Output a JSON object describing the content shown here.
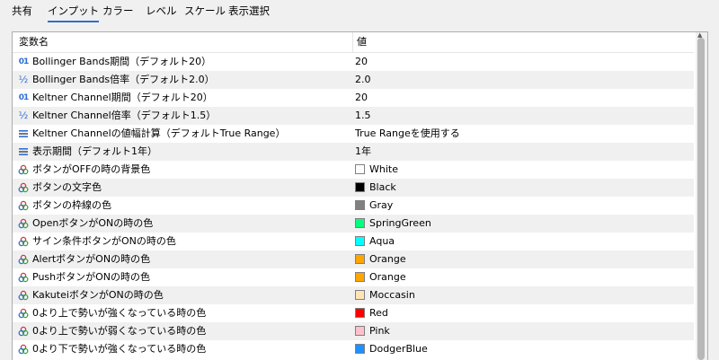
{
  "tabs": [
    {
      "label": "共有",
      "active": false
    },
    {
      "label": "インプット",
      "active": true
    },
    {
      "label": "カラー",
      "active": false
    },
    {
      "label": "レベル",
      "active": false
    },
    {
      "label": "スケール",
      "active": false
    },
    {
      "label": "表示選択",
      "active": false
    }
  ],
  "table": {
    "header_name": "変数名",
    "header_value": "値",
    "rows": [
      {
        "icon": "integer-icon",
        "name": "Bollinger Bands期間（デフォルト20）",
        "value": "20"
      },
      {
        "icon": "fraction-icon",
        "name": "Bollinger Bands倍率（デフォルト2.0）",
        "value": "2.0"
      },
      {
        "icon": "integer-icon",
        "name": "Keltner Channel期間（デフォルト20）",
        "value": "20"
      },
      {
        "icon": "fraction-icon",
        "name": "Keltner Channel倍率（デフォルト1.5）",
        "value": "1.5"
      },
      {
        "icon": "enum-icon",
        "name": "Keltner Channelの値幅計算（デフォルトTrue Range）",
        "value": "True Rangeを使用する"
      },
      {
        "icon": "enum-icon",
        "name": "表示期間（デフォルト1年）",
        "value": "1年"
      },
      {
        "icon": "color-icon",
        "name": "ボタンがOFFの時の背景色",
        "value": "White",
        "swatch": "#ffffff"
      },
      {
        "icon": "color-icon",
        "name": "ボタンの文字色",
        "value": "Black",
        "swatch": "#000000"
      },
      {
        "icon": "color-icon",
        "name": "ボタンの枠線の色",
        "value": "Gray",
        "swatch": "#808080"
      },
      {
        "icon": "color-icon",
        "name": "OpenボタンがONの時の色",
        "value": "SpringGreen",
        "swatch": "#00ff7f"
      },
      {
        "icon": "color-icon",
        "name": "サイン条件ボタンがONの時の色",
        "value": "Aqua",
        "swatch": "#00ffff"
      },
      {
        "icon": "color-icon",
        "name": "AlertボタンがONの時の色",
        "value": "Orange",
        "swatch": "#ffa500"
      },
      {
        "icon": "color-icon",
        "name": "PushボタンがONの時の色",
        "value": "Orange",
        "swatch": "#ffa500"
      },
      {
        "icon": "color-icon",
        "name": "KakuteiボタンがONの時の色",
        "value": "Moccasin",
        "swatch": "#ffe4b5"
      },
      {
        "icon": "color-icon",
        "name": "0より上で勢いが強くなっている時の色",
        "value": "Red",
        "swatch": "#ff0000"
      },
      {
        "icon": "color-icon",
        "name": "0より上で勢いが弱くなっている時の色",
        "value": "Pink",
        "swatch": "#ffc0cb"
      },
      {
        "icon": "color-icon",
        "name": "0より下で勢いが強くなっている時の色",
        "value": "DodgerBlue",
        "swatch": "#1e90ff"
      }
    ]
  },
  "colors": {
    "accent": "#2f6fd1",
    "row_alt": "#f0f0f0"
  }
}
